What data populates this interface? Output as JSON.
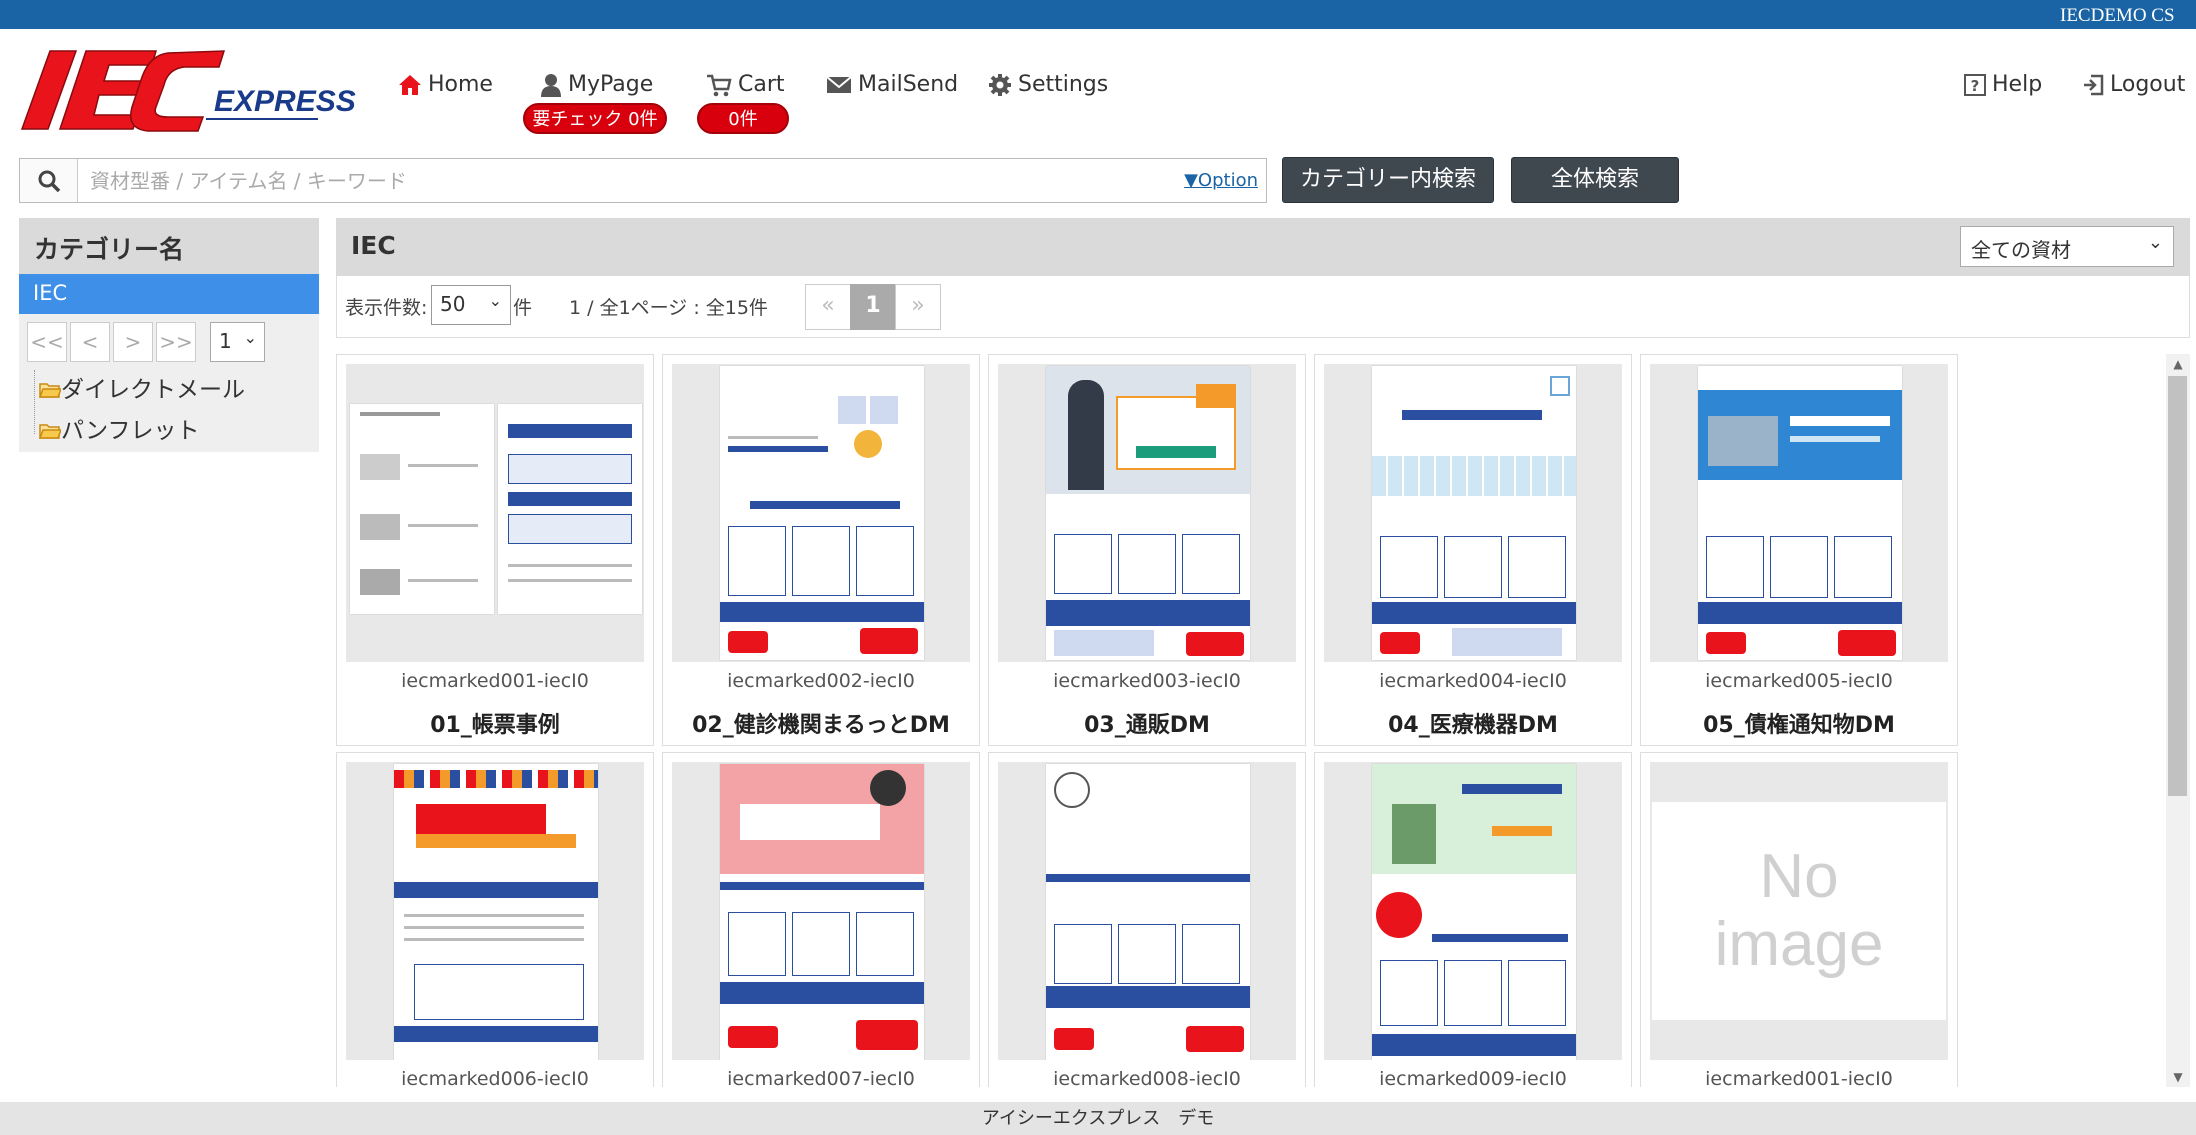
{
  "topbar": {
    "user": "IECDEMO CS"
  },
  "logo": {
    "main": "IEC",
    "sub": "EXPRESS"
  },
  "nav": {
    "home": "Home",
    "mypage": "MyPage",
    "cart": "Cart",
    "mailsend": "MailSend",
    "settings": "Settings",
    "help": "Help",
    "logout": "Logout",
    "mypage_badge": "要チェック 0件",
    "cart_badge": "0件"
  },
  "search": {
    "placeholder": "資材型番 / アイテム名 / キーワード",
    "option": "▼Option",
    "category_search": "カテゴリー内検索",
    "all_search": "全体検索"
  },
  "sidebar": {
    "title": "カテゴリー名",
    "active": "IEC",
    "pager": [
      "<<",
      "<",
      ">",
      ">>"
    ],
    "page_select": "1",
    "folders": [
      "ダイレクトメール",
      "パンフレット"
    ]
  },
  "main": {
    "title": "IEC",
    "filter": "全ての資材",
    "per_page_label": "表示件数:",
    "per_page_value": "50",
    "per_page_unit": "件",
    "page_info": "1 / 全1ページ : 全15件",
    "pager": {
      "prev": "«",
      "current": "1",
      "next": "»"
    }
  },
  "items": [
    {
      "code": "iecmarked001-iecI0",
      "name": "01_帳票事例"
    },
    {
      "code": "iecmarked002-iecI0",
      "name": "02_健診機関まるっとDM"
    },
    {
      "code": "iecmarked003-iecI0",
      "name": "03_通販DM"
    },
    {
      "code": "iecmarked004-iecI0",
      "name": "04_医療機器DM"
    },
    {
      "code": "iecmarked005-iecI0",
      "name": "05_債権通知物DM"
    },
    {
      "code": "iecmarked006-iecI0",
      "name": ""
    },
    {
      "code": "iecmarked007-iecI0",
      "name": ""
    },
    {
      "code": "iecmarked008-iecI0",
      "name": ""
    },
    {
      "code": "iecmarked009-iecI0",
      "name": ""
    },
    {
      "code": "iecmarked001-iecI0",
      "name": ""
    }
  ],
  "noimage": {
    "line1": "No",
    "line2": "image"
  },
  "footer": {
    "text": "アイシーエクスプレス　デモ"
  },
  "colors": {
    "topbar": "#1a64a6",
    "badge": "#d9000d",
    "active": "#3d8fe8",
    "logo_red": "#e8131b"
  }
}
